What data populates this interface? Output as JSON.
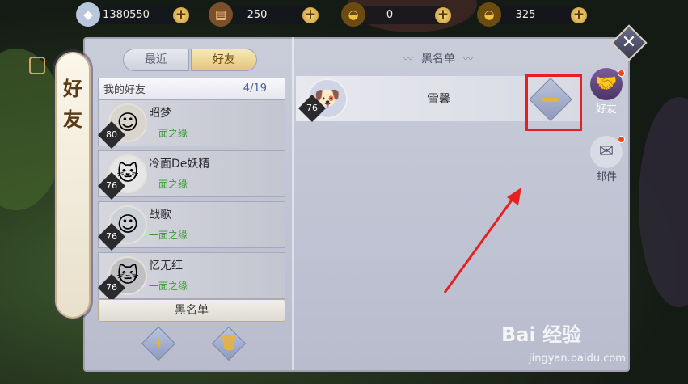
{
  "resources": [
    {
      "icon": "diamond-gem-icon",
      "value": "1380550",
      "color": "#d8e4f3"
    },
    {
      "icon": "scroll-coupon-icon",
      "value": "250",
      "color": "#e2a24a"
    },
    {
      "icon": "gold-ingot-icon",
      "value": "0",
      "color": "#f0c23c"
    },
    {
      "icon": "locked-gold-ingot-icon",
      "value": "325",
      "color": "#f0c23c"
    }
  ],
  "side_title": "好友",
  "tabs": {
    "recent": "最近",
    "friends": "好友"
  },
  "friend_list": {
    "header": "我的好友",
    "count": "4/19",
    "items": [
      {
        "name": "昭梦",
        "level": "80",
        "relation": "一面之缘"
      },
      {
        "name": "冷面De妖精",
        "level": "76",
        "relation": "一面之缘"
      },
      {
        "name": "战歌",
        "level": "76",
        "relation": "一面之缘"
      },
      {
        "name": "忆无红",
        "level": "76",
        "relation": "一面之缘"
      }
    ]
  },
  "blacklist_button": "黑名单",
  "blacklist_panel": {
    "title": "黑名单",
    "entries": [
      {
        "name": "雪馨",
        "level": "76"
      }
    ]
  },
  "nav": {
    "friends": "好友",
    "mail": "邮件"
  },
  "watermark": {
    "logo": "Bai 经验",
    "url": "jingyan.baidu.com"
  },
  "colors": {
    "highlight": "#e62020",
    "accent_gold": "#e6b43a",
    "relation_green": "#3a9a34"
  }
}
